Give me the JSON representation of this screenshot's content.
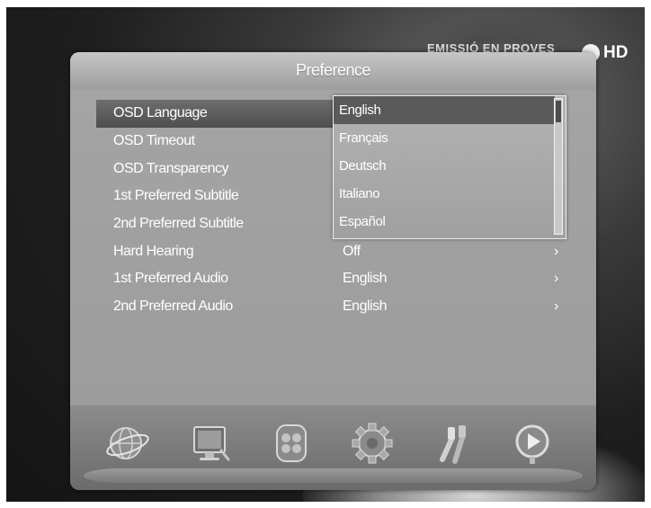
{
  "banner": {
    "channel_text": "EMISSIÓ EN PROVES",
    "hd_label": "HD"
  },
  "dialog": {
    "title": "Preference"
  },
  "menu": {
    "rows": [
      {
        "label": "OSD Language",
        "value": "",
        "selected": true
      },
      {
        "label": "OSD Timeout",
        "value": ""
      },
      {
        "label": "OSD Transparency",
        "value": ""
      },
      {
        "label": "1st Preferred Subtitle",
        "value": ""
      },
      {
        "label": "2nd Preferred Subtitle",
        "value": ""
      },
      {
        "label": "Hard Hearing",
        "value": "Off",
        "arrow": "›"
      },
      {
        "label": "1st Preferred Audio",
        "value": "English",
        "arrow": "›"
      },
      {
        "label": "2nd Preferred Audio",
        "value": "English",
        "arrow": "›"
      }
    ]
  },
  "dropdown": {
    "options": [
      "English",
      "Français",
      "Deutsch",
      "Italiano",
      "Español"
    ],
    "selected": "English"
  },
  "nav_icons": [
    "globe-icon",
    "monitor-icon",
    "film-reel-icon",
    "gear-icon",
    "connector-cables-icon",
    "media-play-icon"
  ],
  "colors": {
    "selection": "#5a5a5a",
    "panel": "#a0a0a0",
    "text": "#ffffff"
  }
}
